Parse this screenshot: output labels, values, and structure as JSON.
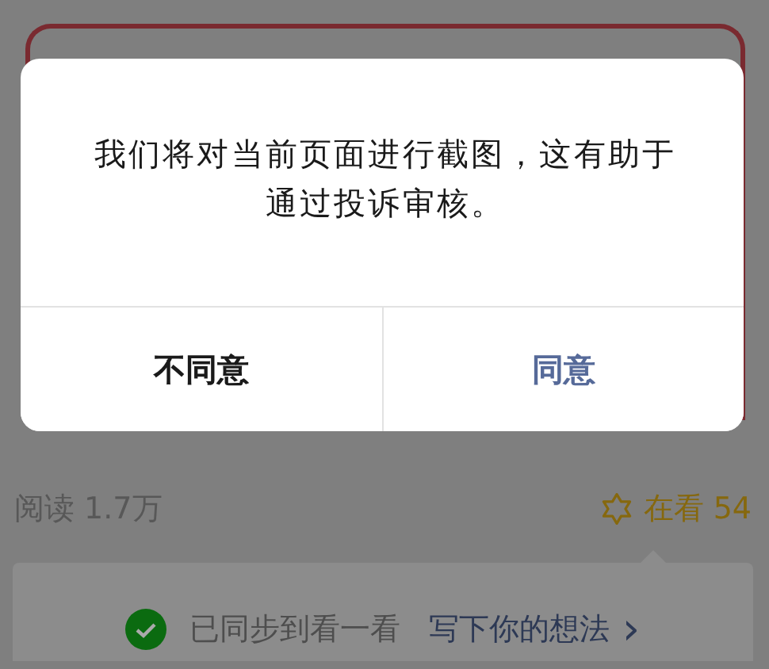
{
  "dialog": {
    "message": "我们将对当前页面进行截图，这有助于通过投诉审核。",
    "buttons": [
      {
        "label": "不同意",
        "kind": "cancel"
      },
      {
        "label": "同意",
        "kind": "confirm"
      }
    ]
  },
  "stats": {
    "reads": "阅读 1.7万",
    "watching": "在看 54"
  },
  "sync": {
    "checked": true,
    "status": "已同步到看一看",
    "link": "写下你的想法",
    "chevron": "›"
  }
}
